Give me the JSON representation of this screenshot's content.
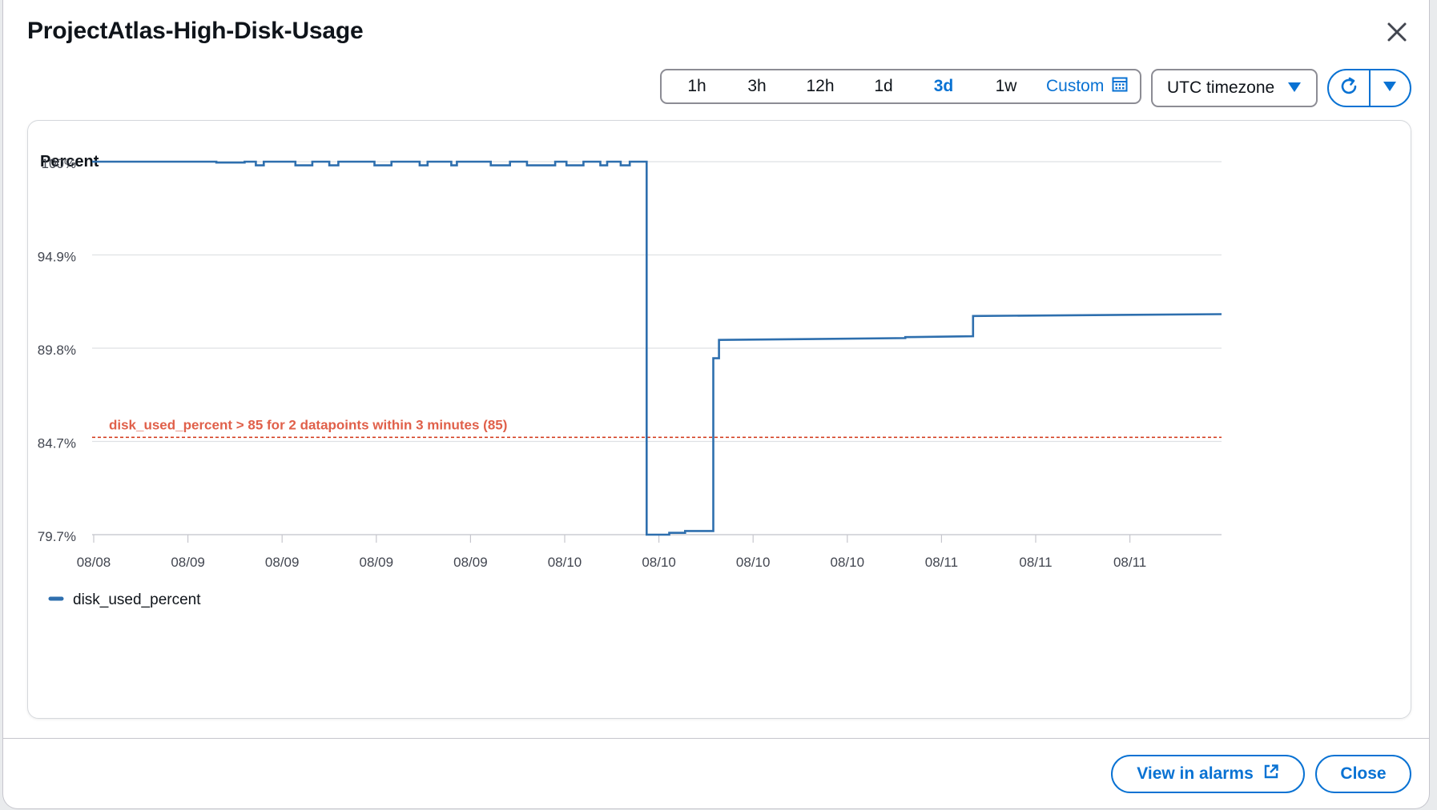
{
  "modal": {
    "title": "ProjectAtlas-High-Disk-Usage"
  },
  "time_range": {
    "options": [
      "1h",
      "3h",
      "12h",
      "1d",
      "3d",
      "1w"
    ],
    "selected": "3d",
    "custom_label": "Custom"
  },
  "timezone": {
    "label": "UTC timezone"
  },
  "footer": {
    "view_alarms_label": "View in alarms",
    "close_label": "Close"
  },
  "colors": {
    "series": "#2e6fae",
    "threshold": "#d13212",
    "accent": "#0972d3"
  },
  "chart_data": {
    "type": "line",
    "ylabel": "Percent",
    "y_ticks": [
      "100%",
      "94.9%",
      "89.8%",
      "84.7%",
      "79.7%"
    ],
    "ylim": [
      79.7,
      100
    ],
    "x_tick_labels": [
      "08/08",
      "08/09",
      "08/09",
      "08/09",
      "08/09",
      "08/10",
      "08/10",
      "08/10",
      "08/10",
      "08/11",
      "08/11",
      "08/11"
    ],
    "grid": true,
    "legend_placement": "bottom-left",
    "threshold": {
      "value": 85,
      "label": "disk_used_percent > 85 for 2 datapoints within 3 minutes (85)"
    },
    "series": [
      {
        "name": "disk_used_percent",
        "step": true,
        "points": [
          [
            0.0,
            100.0
          ],
          [
            0.11,
            100.0
          ],
          [
            0.11,
            99.95
          ],
          [
            0.135,
            99.95
          ],
          [
            0.135,
            100.0
          ],
          [
            0.145,
            100.0
          ],
          [
            0.145,
            99.8
          ],
          [
            0.152,
            99.8
          ],
          [
            0.152,
            100.0
          ],
          [
            0.18,
            100.0
          ],
          [
            0.18,
            99.8
          ],
          [
            0.195,
            99.8
          ],
          [
            0.195,
            100.0
          ],
          [
            0.21,
            100.0
          ],
          [
            0.21,
            99.8
          ],
          [
            0.218,
            99.8
          ],
          [
            0.218,
            100.0
          ],
          [
            0.25,
            100.0
          ],
          [
            0.25,
            99.8
          ],
          [
            0.265,
            99.8
          ],
          [
            0.265,
            100.0
          ],
          [
            0.29,
            100.0
          ],
          [
            0.29,
            99.8
          ],
          [
            0.297,
            99.8
          ],
          [
            0.297,
            100.0
          ],
          [
            0.318,
            100.0
          ],
          [
            0.318,
            99.8
          ],
          [
            0.323,
            99.8
          ],
          [
            0.323,
            100.0
          ],
          [
            0.353,
            100.0
          ],
          [
            0.353,
            99.8
          ],
          [
            0.37,
            99.8
          ],
          [
            0.37,
            100.0
          ],
          [
            0.385,
            100.0
          ],
          [
            0.385,
            99.8
          ],
          [
            0.41,
            99.8
          ],
          [
            0.41,
            100.0
          ],
          [
            0.42,
            100.0
          ],
          [
            0.42,
            99.8
          ],
          [
            0.435,
            99.8
          ],
          [
            0.435,
            100.0
          ],
          [
            0.45,
            100.0
          ],
          [
            0.45,
            99.8
          ],
          [
            0.456,
            99.8
          ],
          [
            0.456,
            100.0
          ],
          [
            0.468,
            100.0
          ],
          [
            0.468,
            99.8
          ],
          [
            0.476,
            99.8
          ],
          [
            0.476,
            100.0
          ],
          [
            0.491,
            100.0
          ],
          [
            0.491,
            79.7
          ],
          [
            0.511,
            79.7
          ],
          [
            0.511,
            79.8
          ],
          [
            0.525,
            79.8
          ],
          [
            0.525,
            79.9
          ],
          [
            0.55,
            79.9
          ],
          [
            0.55,
            89.3
          ],
          [
            0.555,
            89.3
          ],
          [
            0.555,
            90.3
          ],
          [
            0.72,
            90.4
          ],
          [
            0.72,
            90.45
          ],
          [
            0.78,
            90.5
          ],
          [
            0.78,
            91.6
          ],
          [
            1.0,
            91.7
          ]
        ]
      }
    ]
  }
}
